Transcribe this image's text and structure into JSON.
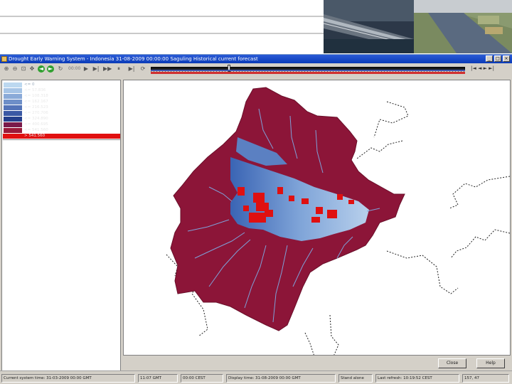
{
  "window": {
    "title": "Drought Early Warning System - Indonesia 31-08-2009 00:00:00 Saguling Historical current forecast"
  },
  "toolbar": {
    "time_label": "00:00",
    "right_glyphs": "|◄ ◄ ► ►|"
  },
  "legend": {
    "items": [
      {
        "label": "<= 0",
        "color": "#bcd8f0"
      },
      {
        "label": "<= 57.836",
        "color": "#a6c4e6"
      },
      {
        "label": "<= 108.318",
        "color": "#8aaad8"
      },
      {
        "label": "<= 162.167",
        "color": "#6e8fc8"
      },
      {
        "label": "<= 216.523",
        "color": "#5474b8"
      },
      {
        "label": "<= 270.706",
        "color": "#3a58a4"
      },
      {
        "label": "<= 324.890",
        "color": "#243f8c"
      },
      {
        "label": "<= 400.695",
        "color": "#7a1a4a"
      },
      {
        "label": "<= 541.560",
        "color": "#9a1a3a"
      },
      {
        "label": "> 541.560",
        "color": "#e01010"
      }
    ]
  },
  "buttons": {
    "close": "Close",
    "help": "Help"
  },
  "statusbar": {
    "cells": [
      "Current system time: 31-03-2009 00:00 GMT",
      "11:07 GMT",
      "00:00 CEST",
      "Display time: 31-08-2009 00:00 GMT",
      "Stand alone",
      "Last refresh: 10:19:52 CEST",
      "157, 47"
    ]
  },
  "colors": {
    "catchment": "#8c1538",
    "river": "#7fa0d8",
    "deficit": "#e01010"
  }
}
